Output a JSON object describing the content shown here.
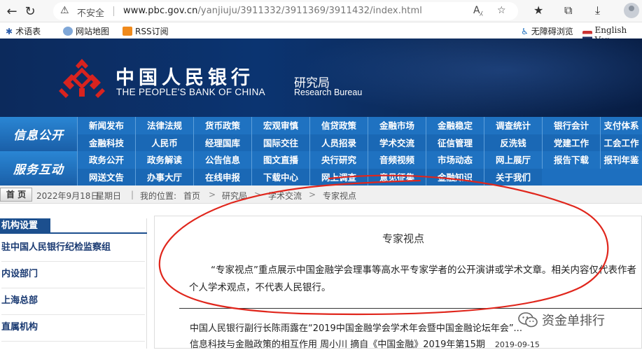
{
  "browser": {
    "security_label": "不安全",
    "url_host": "www.pbc.gov.cn",
    "url_path": "/yanjiuju/3911332/3911369/3911432/index.html"
  },
  "utility": {
    "items": [
      "术语表",
      "网站地图",
      "RSS订阅"
    ],
    "accessibility": "无障碍浏览",
    "english": "English Ver"
  },
  "banner": {
    "bank_name_cn": "中国人民银行",
    "bank_name_en": "THE PEOPLE'S BANK OF CHINA",
    "bureau_cn": "研究局",
    "bureau_en": "Research Bureau"
  },
  "nav": {
    "section1": "信息公开",
    "section2": "服务互动",
    "rows": [
      [
        "新闻发布",
        "法律法规",
        "货币政策",
        "宏观审慎",
        "信贷政策",
        "金融市场",
        "金融稳定",
        "调查统计",
        "银行会计",
        "支付体系"
      ],
      [
        "金融科技",
        "人民币",
        "经理国库",
        "国际交往",
        "人员招录",
        "学术交流",
        "征信管理",
        "反洗钱",
        "党建工作",
        "工会工作"
      ],
      [
        "政务公开",
        "政务解读",
        "公告信息",
        "图文直播",
        "央行研究",
        "音频视频",
        "市场动态",
        "网上展厅",
        "报告下载",
        "报刊年鉴"
      ],
      [
        "网送文告",
        "办事大厅",
        "在线申报",
        "下载中心",
        "网上调查",
        "意见征集",
        "金融知识",
        "关于我们"
      ]
    ]
  },
  "breadcrumb": {
    "home": "首 页",
    "date": "2022年9月18日",
    "weekday": "星期日",
    "location_label": "我的位置:",
    "path": [
      "首页",
      "研究局",
      "学术交流",
      "专家视点"
    ]
  },
  "sidebar": {
    "heading": "机构设置",
    "items": [
      "驻中国人民银行纪检监察组",
      "内设部门",
      "上海总部",
      "直属机构"
    ]
  },
  "main": {
    "title": "专家视点",
    "intro": "“专家视点”重点展示中国金融学会理事等高水平专家学者的公开演讲或学术文章。相关内容仅代表作者个人学术观点，不代表人民银行。",
    "articles": [
      {
        "title": "中国人民银行副行长陈雨露在“2019中国金融学会学术年会暨中国金融论坛年会”...",
        "date": ""
      },
      {
        "title": "信息科技与金融政策的相互作用 周小川 摘自《中国金融》2019年第15期",
        "date": "2019-09-15"
      }
    ]
  },
  "watermark": {
    "text": "资金单排行"
  },
  "colors": {
    "nav_blue": "#1d6fbf",
    "banner_navy": "#0b3471",
    "logo_red": "#d8231f",
    "annotation_red": "#e0261c"
  }
}
